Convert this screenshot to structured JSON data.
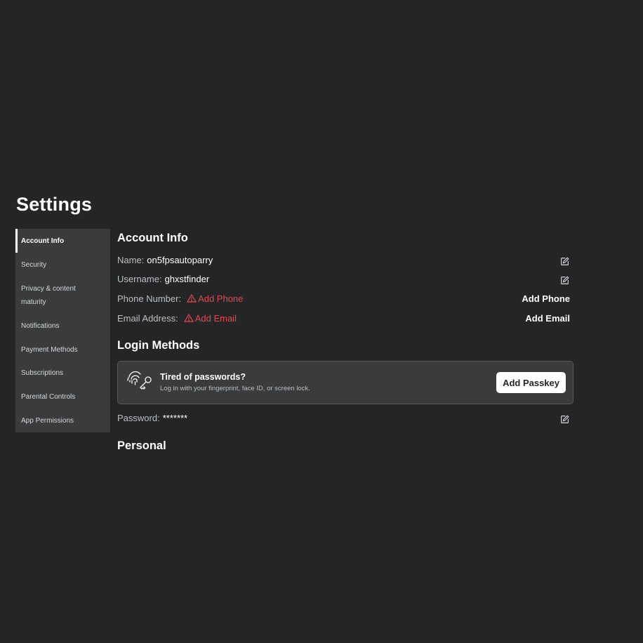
{
  "page": {
    "title": "Settings"
  },
  "sidebar": {
    "items": [
      {
        "label": "Account Info",
        "active": true
      },
      {
        "label": "Security"
      },
      {
        "label": "Privacy & content maturity"
      },
      {
        "label": "Notifications"
      },
      {
        "label": "Payment Methods"
      },
      {
        "label": "Subscriptions"
      },
      {
        "label": "Parental Controls"
      },
      {
        "label": "App Permissions"
      }
    ]
  },
  "account_info": {
    "heading": "Account Info",
    "name_label": "Name:",
    "name_value": "on5fpsautoparry",
    "username_label": "Username:",
    "username_value": "ghxstfinder",
    "phone_label": "Phone Number:",
    "phone_warning": "Add Phone",
    "phone_action": "Add Phone",
    "email_label": "Email Address:",
    "email_warning": "Add Email",
    "email_action": "Add Email"
  },
  "login_methods": {
    "heading": "Login Methods",
    "passkey_title": "Tired of passwords?",
    "passkey_subtitle": "Log in with your fingerprint, face ID, or screen lock.",
    "passkey_button": "Add Passkey",
    "password_label": "Password:",
    "password_value": "*******"
  },
  "personal": {
    "heading": "Personal"
  },
  "colors": {
    "background": "#232527",
    "sidebar": "#393b3d",
    "warning": "#e5484d",
    "text": "#ffffff",
    "muted": "#bdbfc1"
  },
  "icons": {
    "edit": "edit-icon",
    "warning": "warning-triangle-icon",
    "passkey": "fingerprint-key-icon"
  }
}
